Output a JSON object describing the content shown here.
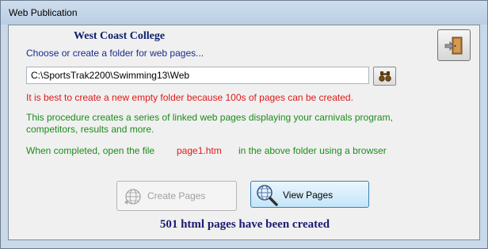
{
  "window": {
    "title": "Web Publication"
  },
  "header": {
    "school": "West Coast College",
    "instruction": "Choose or create a folder for web pages..."
  },
  "folder": {
    "path": "C:\\SportsTrak2200\\Swimming13\\Web"
  },
  "messages": {
    "warning": "It is best to create a new empty folder because 100s of pages can be created.",
    "description_line1": "This procedure creates a series of linked web pages displaying your carnivals program,",
    "description_line2": "competitors, results and more.",
    "completed_prefix": "When completed, open the file",
    "completed_file": "page1.htm",
    "completed_suffix": "in the above folder using a browser"
  },
  "buttons": {
    "create_label": "Create Pages",
    "view_label": "View Pages",
    "create_enabled": false
  },
  "status": {
    "text": "501 html pages have been created"
  },
  "icons": {
    "exit": "exit-door-icon",
    "browse": "binoculars-icon",
    "create": "globe-icon",
    "view": "magnifier-globe-icon"
  },
  "colors": {
    "warning": "#e01818",
    "info": "#1c8c1c",
    "heading": "#0b1f6b",
    "status": "#1b1b72"
  }
}
